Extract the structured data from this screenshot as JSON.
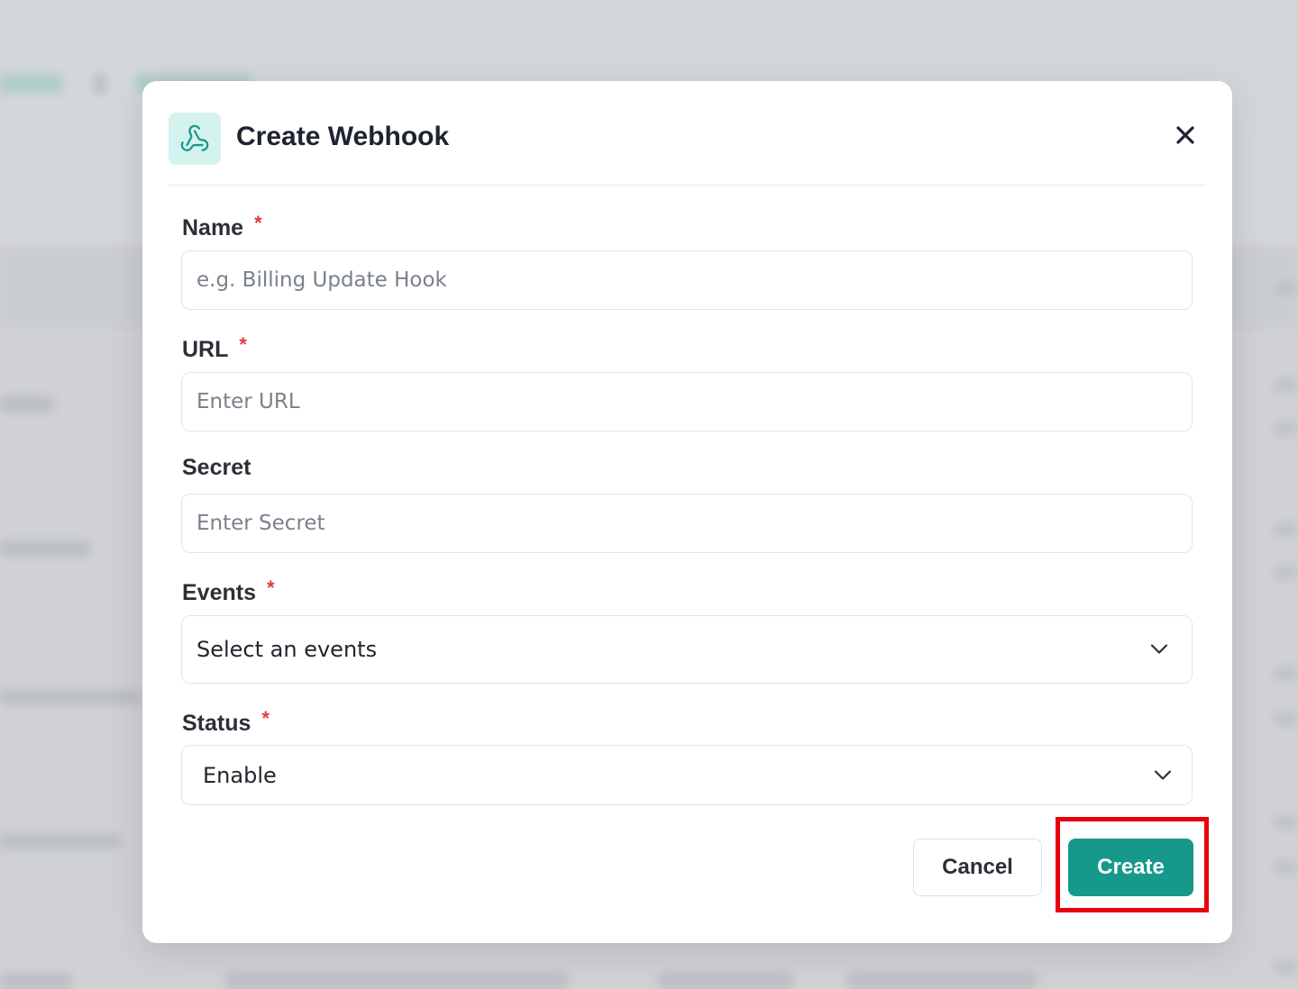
{
  "modal": {
    "title": "Create Webhook",
    "header_icon": "webhook-icon",
    "close_icon": "close-icon",
    "accent_color": "#16998a"
  },
  "fields": {
    "name": {
      "label": "Name",
      "required_mark": "*",
      "placeholder": "e.g. Billing Update Hook",
      "value": ""
    },
    "url": {
      "label": "URL",
      "required_mark": "*",
      "placeholder": "Enter URL",
      "value": ""
    },
    "secret": {
      "label": "Secret",
      "placeholder": "Enter Secret",
      "value": ""
    },
    "events": {
      "label": "Events",
      "required_mark": "*",
      "selected": "Select an events"
    },
    "status": {
      "label": "Status",
      "required_mark": "*",
      "selected": "Enable"
    }
  },
  "actions": {
    "cancel_label": "Cancel",
    "create_label": "Create",
    "highlight_color": "#e8000b"
  }
}
